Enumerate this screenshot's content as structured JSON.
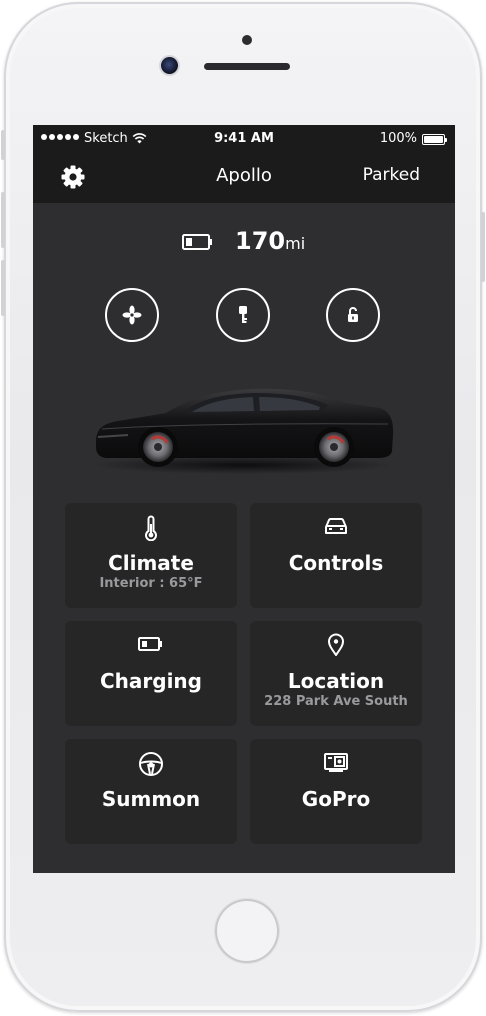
{
  "status_bar": {
    "carrier": "Sketch",
    "time": "9:41 AM",
    "battery_percent": "100%"
  },
  "nav": {
    "title": "Apollo",
    "status": "Parked",
    "left_icon": "gear-icon"
  },
  "range": {
    "value": "170",
    "unit": "mi",
    "icon": "battery-icon"
  },
  "quick_actions": [
    {
      "icon": "fan-icon"
    },
    {
      "icon": "key-icon"
    },
    {
      "icon": "lock-icon"
    }
  ],
  "tiles": [
    {
      "title": "Climate",
      "subtitle": "Interior : 65°F",
      "icon": "thermometer-icon"
    },
    {
      "title": "Controls",
      "subtitle": "",
      "icon": "car-icon"
    },
    {
      "title": "Charging",
      "subtitle": "",
      "icon": "battery-icon"
    },
    {
      "title": "Location",
      "subtitle": "228 Park Ave South",
      "icon": "location-pin-icon"
    },
    {
      "title": "Summon",
      "subtitle": "",
      "icon": "steering-wheel-icon"
    },
    {
      "title": "GoPro",
      "subtitle": "",
      "icon": "camera-icon"
    }
  ],
  "colors": {
    "screen_bg": "#2e2e30",
    "bar_bg": "#1b1b1c",
    "tile_bg": "#262627",
    "text": "#ffffff",
    "subtext": "#9a9a9d"
  }
}
